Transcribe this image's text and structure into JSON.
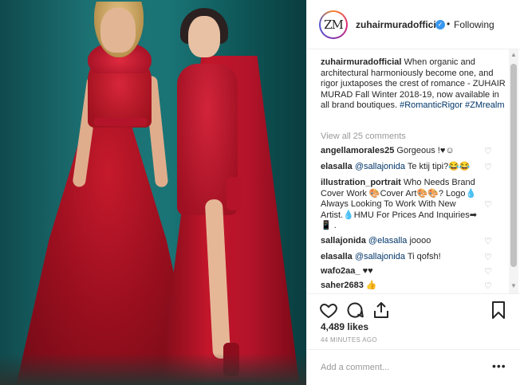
{
  "post": {
    "username": "zuhairmuradofficial",
    "avatar_text": "ZM",
    "separator": "•",
    "follow_state": "Following",
    "caption": {
      "user": "zuhairmuradofficial",
      "text": "When organic and architectural harmoniously become one, and rigor juxtaposes the crest of romance - ZUHAIR MURAD Fall Winter 2018-19, now available in all brand boutiques.",
      "hashtags": "#RomanticRigor #ZMrealm"
    },
    "view_all": "View all 25 comments",
    "comments": [
      {
        "user": "angellamorales25",
        "text": "Gorgeous !♥☺"
      },
      {
        "user": "elasalla",
        "mention": "@sallajonida",
        "text": "Te ktij tipi?😂😂"
      },
      {
        "user": "illustration_portrait",
        "text": "Who Needs Brand Cover Work 🎨Cover Art🎨🎨? Logo💧 Always Looking To Work With New Artist.💧HMU For Prices And Inquiries➡📱 ."
      },
      {
        "user": "sallajonida",
        "mention": "@elasalla",
        "text": "joooo"
      },
      {
        "user": "elasalla",
        "mention": "@sallajonida",
        "text": "Ti qofsh!"
      },
      {
        "user": "wafo2aa_",
        "text": "♥♥"
      },
      {
        "user": "saher2683",
        "text": "👍"
      }
    ],
    "likes": "4,489 likes",
    "timestamp": "44 MINUTES AGO",
    "add_comment_placeholder": "Add a comment...",
    "more_label": "•••",
    "verified_mark": "✓",
    "heart_glyph": "♡"
  }
}
